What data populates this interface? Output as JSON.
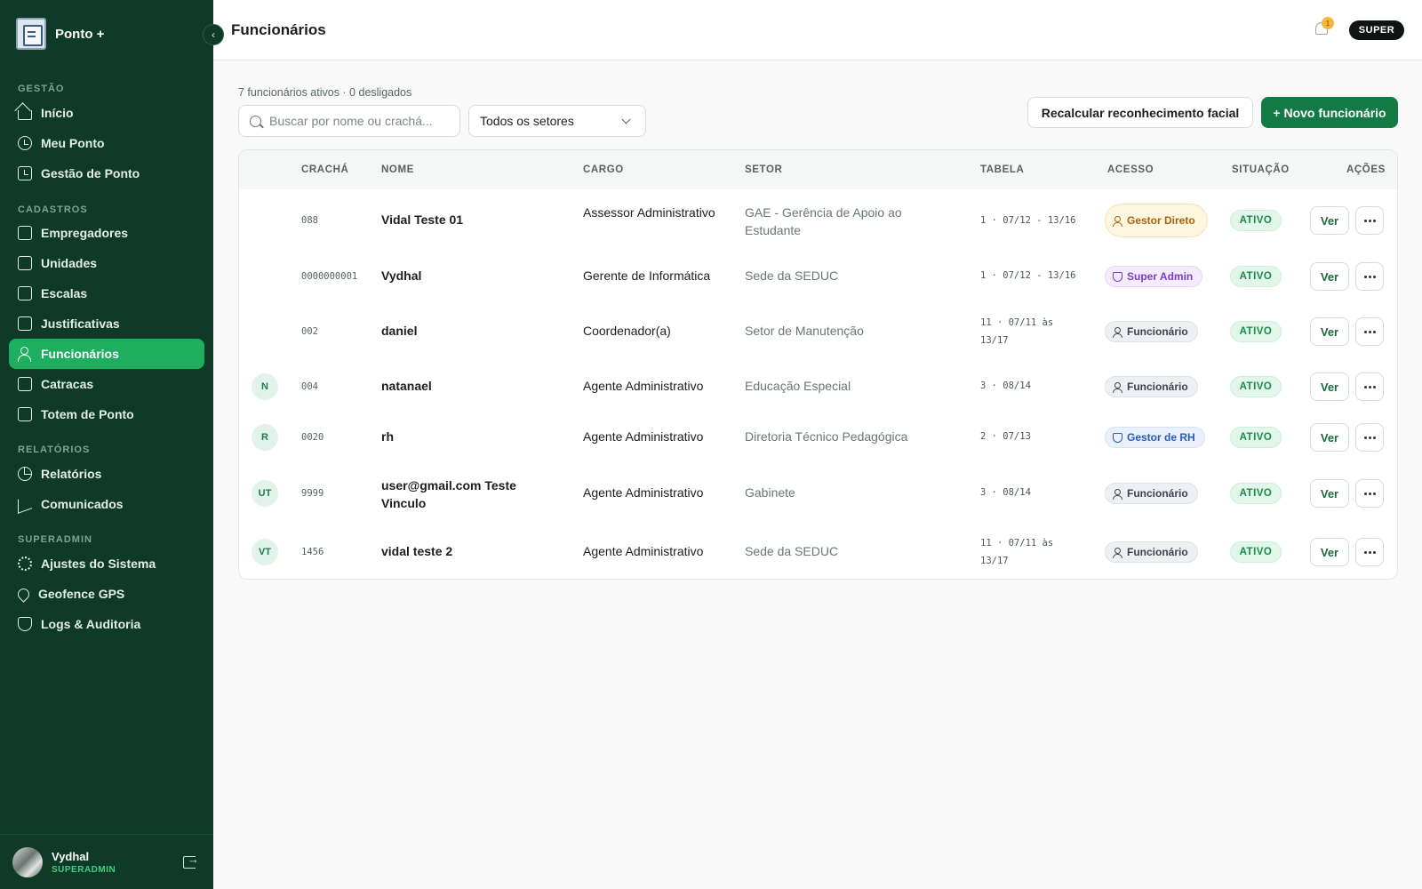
{
  "app": {
    "name": "Ponto +"
  },
  "sidebar": {
    "sections": {
      "gestao": "GESTÃO",
      "cadastros": "CADASTROS",
      "relatorios": "RELATÓRIOS",
      "superadmin": "SUPERADMIN"
    },
    "items": [
      {
        "label": "Início",
        "icon": "home-icon"
      },
      {
        "label": "Meu Ponto",
        "icon": "clock-icon"
      },
      {
        "label": "Gestão de Ponto",
        "icon": "calendar-clock-icon"
      },
      {
        "label": "Empregadores",
        "icon": "building-icon"
      },
      {
        "label": "Unidades",
        "icon": "landmark-icon"
      },
      {
        "label": "Escalas",
        "icon": "calendar-icon"
      },
      {
        "label": "Justificativas",
        "icon": "clipboard-icon"
      },
      {
        "label": "Funcionários",
        "icon": "users-icon"
      },
      {
        "label": "Catracas",
        "icon": "turnstile-icon"
      },
      {
        "label": "Totem de Ponto",
        "icon": "face-scan-icon"
      },
      {
        "label": "Relatórios",
        "icon": "chart-pie-icon"
      },
      {
        "label": "Comunicados",
        "icon": "megaphone-icon"
      },
      {
        "label": "Ajustes do Sistema",
        "icon": "gear-icon"
      },
      {
        "label": "Geofence GPS",
        "icon": "map-pin-icon"
      },
      {
        "label": "Logs & Auditoria",
        "icon": "shield-icon"
      }
    ],
    "active": "Funcionários",
    "user": {
      "name": "Vydhal",
      "role": "SUPERADMIN"
    }
  },
  "header": {
    "title": "Funcionários",
    "notifications": "1",
    "role_pill": "SUPER"
  },
  "toolbar": {
    "summary": "7 funcionários ativos · 0 desligados",
    "search_placeholder": "Buscar por nome ou crachá...",
    "sector_filter": "Todos os setores",
    "recalc_label": "Recalcular reconhecimento facial",
    "new_label": "+ Novo funcionário"
  },
  "table": {
    "columns": [
      "CRACHÁ",
      "NOME",
      "CARGO",
      "SETOR",
      "TABELA",
      "ACESSO",
      "SITUAÇÃO",
      "AÇÕES"
    ],
    "rows": [
      {
        "initials": "",
        "badge": "088",
        "name": "Vidal Teste 01",
        "cargo": "Assessor Administrativo",
        "setor": "GAE - Gerência de Apoio ao Estudante",
        "tabela": "1 · 07/12 - 13/16",
        "acesso": "Gestor Direto",
        "acesso_type": "gestor",
        "situacao": "ATIVO",
        "view": "Ver"
      },
      {
        "initials": "",
        "badge": "0000000001",
        "name": "Vydhal",
        "cargo": "Gerente de Informática",
        "setor": "Sede da SEDUC",
        "tabela": "1 · 07/12 - 13/16",
        "acesso": "Super Admin",
        "acesso_type": "super",
        "situacao": "ATIVO",
        "view": "Ver"
      },
      {
        "initials": "",
        "badge": "002",
        "name": "daniel",
        "cargo": "Coordenador(a)",
        "setor": "Setor de Manutenção",
        "tabela": "11 · 07/11 às 13/17",
        "acesso": "Funcionário",
        "acesso_type": "func",
        "situacao": "ATIVO",
        "view": "Ver"
      },
      {
        "initials": "N",
        "badge": "004",
        "name": "natanael",
        "cargo": "Agente Administrativo",
        "setor": "Educação Especial",
        "tabela": "3 · 08/14",
        "acesso": "Funcionário",
        "acesso_type": "func",
        "situacao": "ATIVO",
        "view": "Ver"
      },
      {
        "initials": "R",
        "badge": "0020",
        "name": "rh",
        "cargo": "Agente Administrativo",
        "setor": "Diretoria Técnico Pedagógica",
        "tabela": "2 · 07/13",
        "acesso": "Gestor de RH",
        "acesso_type": "rh",
        "situacao": "ATIVO",
        "view": "Ver"
      },
      {
        "initials": "UT",
        "badge": "9999",
        "name": "user@gmail.com Teste Vinculo",
        "cargo": "Agente Administrativo",
        "setor": "Gabinete",
        "tabela": "3 · 08/14",
        "acesso": "Funcionário",
        "acesso_type": "func",
        "situacao": "ATIVO",
        "view": "Ver"
      },
      {
        "initials": "VT",
        "badge": "1456",
        "name": "vidal teste 2",
        "cargo": "Agente Administrativo",
        "setor": "Sede da SEDUC",
        "tabela": "11 · 07/11 às 13/17",
        "acesso": "Funcionário",
        "acesso_type": "func",
        "situacao": "ATIVO",
        "view": "Ver"
      }
    ]
  },
  "colors": {
    "sidebar_bg": "#0e3a27",
    "active_item": "#1eae5f",
    "primary_button": "#147a45",
    "status_active": "#1a8a4c"
  }
}
